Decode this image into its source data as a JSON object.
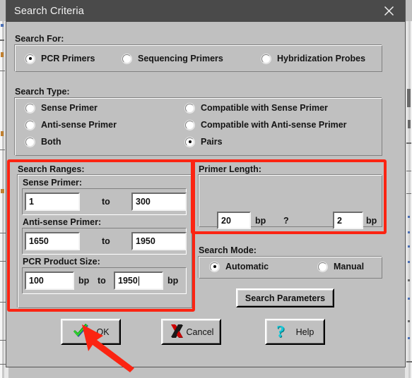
{
  "window": {
    "title": "Search Criteria",
    "close_icon": "close-icon",
    "titlebar_color": "#4a4a4a",
    "face_color": "#c0c0c0"
  },
  "search_for": {
    "label": "Search For:",
    "options": [
      {
        "label": "PCR Primers",
        "selected": true
      },
      {
        "label": "Sequencing Primers",
        "selected": false
      },
      {
        "label": "Hybridization Probes",
        "selected": false
      }
    ]
  },
  "search_type": {
    "label": "Search Type:",
    "options_left": [
      {
        "label": "Sense Primer",
        "selected": false
      },
      {
        "label": "Anti-sense Primer",
        "selected": false
      },
      {
        "label": "Both",
        "selected": false
      }
    ],
    "options_right": [
      {
        "label": "Compatible with Sense Primer",
        "selected": false
      },
      {
        "label": "Compatible with Anti-sense Primer",
        "selected": false
      },
      {
        "label": "Pairs",
        "selected": true
      }
    ]
  },
  "search_ranges": {
    "label": "Search Ranges:",
    "sense_primer": {
      "label": "Sense Primer:",
      "from": "1",
      "to_label": "to",
      "to": "300"
    },
    "antisense_primer": {
      "label": "Anti-sense Primer:",
      "from": "1650",
      "to_label": "to",
      "to": "1950"
    },
    "pcr_product_size": {
      "label": "PCR Product Size:",
      "from": "100",
      "unit_left": "bp",
      "to_label": "to",
      "to": "1950",
      "to_focused": true,
      "unit_right": "bp"
    }
  },
  "primer_length": {
    "label": "Primer Length:",
    "value": "20",
    "unit_left": "bp",
    "separator": "?",
    "tolerance": "2",
    "unit_right": "bp"
  },
  "search_mode": {
    "label": "Search Mode:",
    "options": [
      {
        "label": "Automatic",
        "selected": true
      },
      {
        "label": "Manual",
        "selected": false
      }
    ]
  },
  "search_parameters_button": {
    "label": "Search Parameters"
  },
  "buttons": [
    {
      "label": "OK",
      "icon": "green-check-icon"
    },
    {
      "label": "Cancel",
      "icon": "red-x-icon"
    },
    {
      "label": "Help",
      "icon": "cyan-question-icon"
    }
  ],
  "annotations": {
    "color": "#fb2412",
    "boxes": [
      {
        "name": "search-ranges-highlight"
      },
      {
        "name": "primer-length-highlight"
      }
    ],
    "arrow": {
      "name": "ok-button-arrow",
      "points_to": "OK"
    }
  }
}
